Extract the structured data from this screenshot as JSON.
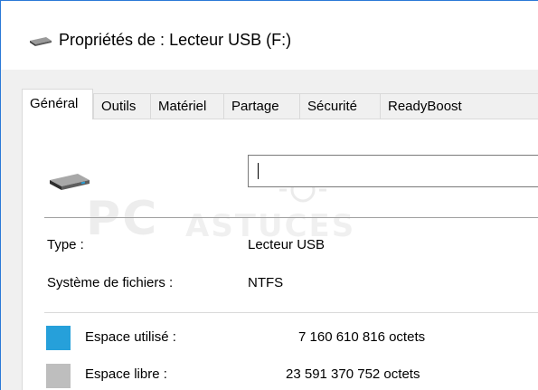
{
  "window": {
    "title": "Propriétés de : Lecteur USB (F:)",
    "title_icon": "usb-drive-icon"
  },
  "tabs": [
    {
      "label": "Général",
      "active": true
    },
    {
      "label": "Outils",
      "active": false
    },
    {
      "label": "Matériel",
      "active": false
    },
    {
      "label": "Partage",
      "active": false
    },
    {
      "label": "Sécurité",
      "active": false
    },
    {
      "label": "ReadyBoost",
      "active": false
    }
  ],
  "general": {
    "drive_icon": "usb-drive-icon",
    "name_value": "",
    "type_label": "Type :",
    "type_value": "Lecteur USB",
    "fs_label": "Système de fichiers :",
    "fs_value": "NTFS",
    "used_label": "Espace utilisé :",
    "used_value": "7 160 610 816 octets",
    "free_label": "Espace libre :",
    "free_value": "23 591 370 752 octets"
  },
  "watermark": {
    "text_pc": "PC",
    "text_astuces": "ASTUCES"
  },
  "colors": {
    "used": "#26a0da",
    "free": "#bebebe",
    "window_border": "#2b79d7"
  }
}
